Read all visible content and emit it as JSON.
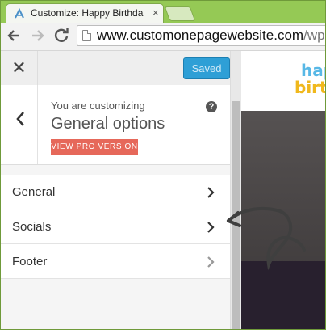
{
  "browser": {
    "tab_title": "Customize: Happy Birthda",
    "tab_close": "×",
    "url_host": "www.customonepagewebsite.com",
    "url_rest": "/wp-a"
  },
  "customizer": {
    "close_label": "✕",
    "saved_label": "Saved",
    "you_are_customizing": "You are customizing",
    "section_title": "General options",
    "pro_button": "VIEW PRO VERSION",
    "help_label": "?",
    "menu_items": [
      {
        "label": "General"
      },
      {
        "label": "Socials"
      },
      {
        "label": "Footer"
      }
    ]
  },
  "preview": {
    "logo_line1": "happ",
    "logo_line2": "birth"
  },
  "colors": {
    "browser_frame": "#95c955",
    "saved_button": "#2e9fd6",
    "pro_button": "#e6685a"
  }
}
